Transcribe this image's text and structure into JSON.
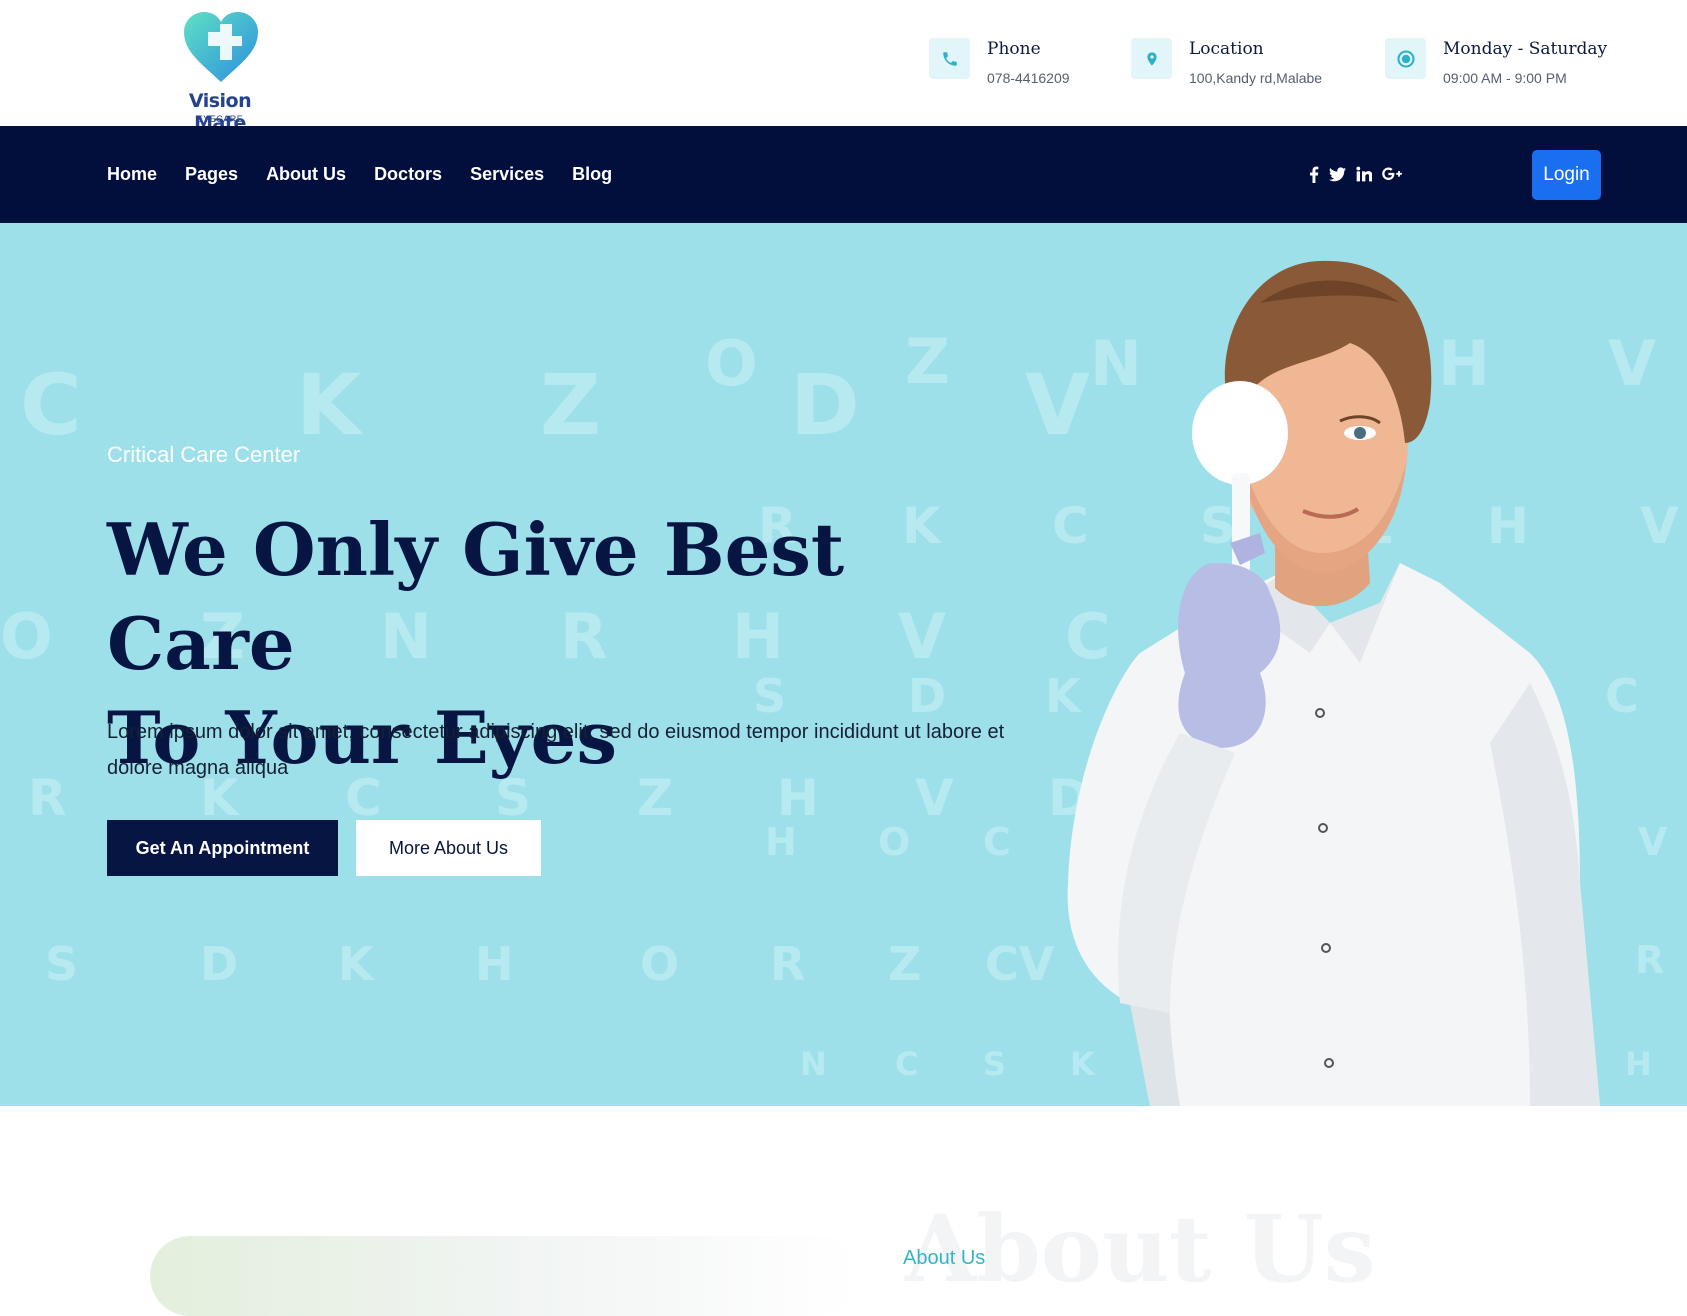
{
  "brand": {
    "name": "Vision Mate",
    "tagline": "EYECARE"
  },
  "contact": [
    {
      "title": "Phone",
      "value": "078-4416209",
      "icon": "phone-icon"
    },
    {
      "title": "Location",
      "value": "100,Kandy rd,Malabe",
      "icon": "location-pin-icon"
    },
    {
      "title": "Monday - Saturday",
      "value": "09:00 AM - 9:00 PM",
      "icon": "clock-icon"
    }
  ],
  "nav": {
    "items": [
      "Home",
      "Pages",
      "About Us",
      "Doctors",
      "Services",
      "Blog"
    ],
    "social": [
      "facebook-icon",
      "twitter-icon",
      "linkedin-icon",
      "google-plus-icon"
    ],
    "login_label": "Login"
  },
  "hero": {
    "subtitle": "Critical Care Center",
    "title_line1": "We Only Give Best Care",
    "title_line2": "To Your Eyes",
    "text": "Lorem ipsum dolor sit amet, consectetur adipiscing elit, sed do eiusmod tempor incididunt ut labore et dolore magna aliqua",
    "primary_button": "Get An Appointment",
    "secondary_button": "More About Us"
  },
  "about": {
    "tag": "About Us",
    "watermark": "About Us"
  },
  "colors": {
    "navy": "#020f3c",
    "hero_bg": "#9de0ea",
    "accent_blue": "#1a6ff0",
    "teal": "#35b4c8"
  }
}
